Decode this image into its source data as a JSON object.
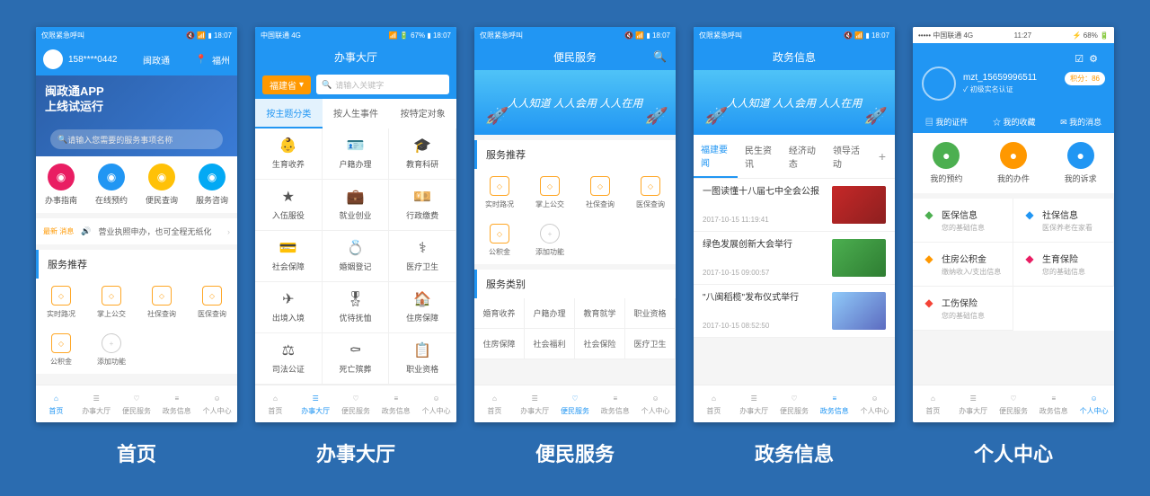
{
  "labels": [
    "首页",
    "办事大厅",
    "便民服务",
    "政务信息",
    "个人中心"
  ],
  "status": {
    "left": "仅限紧急呼叫",
    "right": "18:07",
    "carrier": "中国联通  4G",
    "batt": "67%",
    "time2": "11:27",
    "batt2": "68%"
  },
  "bottomTabs": [
    "首页",
    "办事大厅",
    "便民服务",
    "政务信息",
    "个人中心"
  ],
  "p1": {
    "phone": "158****0442",
    "app": "闽政通",
    "loc": "福州",
    "bannerL1": "闽政通APP",
    "bannerL2": "上线试运行",
    "searchPh": "请输入您需要的服务事项名称",
    "quick": [
      {
        "t": "办事指南",
        "c": "#e91e63"
      },
      {
        "t": "在线预约",
        "c": "#2196f3"
      },
      {
        "t": "便民查询",
        "c": "#ffc107"
      },
      {
        "t": "服务咨询",
        "c": "#03a9f4"
      }
    ],
    "noticeTag": "最新\n消息",
    "notice": "营业执照申办，也可全程无纸化",
    "sectTitle": "服务推荐",
    "svcs": [
      "实时路况",
      "掌上公交",
      "社保查询",
      "医保查询",
      "公积金",
      "添加功能"
    ]
  },
  "p2": {
    "title": "办事大厅",
    "prov": "福建省",
    "searchPh": "请输入关键字",
    "tabs": [
      "按主题分类",
      "按人生事件",
      "按特定对象"
    ],
    "items": [
      "生育收养",
      "户籍办理",
      "教育科研",
      "入伍服役",
      "就业创业",
      "行政缴费",
      "社会保障",
      "婚姻登记",
      "医疗卫生",
      "出境入境",
      "优待抚恤",
      "住房保障",
      "司法公证",
      "死亡殡葬",
      "职业资格"
    ]
  },
  "p3": {
    "title": "便民服务",
    "banner": "人人知道 人人会用 人人在用",
    "sect1": "服务推荐",
    "svcs": [
      "实时路况",
      "掌上公交",
      "社保查询",
      "医保查询",
      "公积金",
      "添加功能"
    ],
    "sect2": "服务类别",
    "cats": [
      "婚育收养",
      "户籍办理",
      "教育就学",
      "职业资格",
      "住房保障",
      "社会福利",
      "社会保险",
      "医疗卫生"
    ]
  },
  "p4": {
    "title": "政务信息",
    "banner": "人人知道 人人会用 人人在用",
    "tabs": [
      "福建要闻",
      "民生资讯",
      "经济动态",
      "领导活动"
    ],
    "news": [
      {
        "t": "一图读懂十八届七中全会公报",
        "d": "2017-10-15 11:19:41"
      },
      {
        "t": "绿色发展创新大会举行",
        "d": "2017-10-15 09:00:57"
      },
      {
        "t": "\"八闽稻榄\"发布仪式举行",
        "d": "2017-10-15 08:52:50"
      }
    ]
  },
  "p5": {
    "user": "mzt_15659996511",
    "verify": "初级实名认证",
    "score": "积分：86",
    "links": [
      "我的证件",
      "我的收藏",
      "我的消息"
    ],
    "acts": [
      {
        "t": "我的预约",
        "c": "#4caf50"
      },
      {
        "t": "我的办件",
        "c": "#ff9800"
      },
      {
        "t": "我的诉求",
        "c": "#2196f3"
      }
    ],
    "info": [
      {
        "t": "医保信息",
        "s": "您的基础信息",
        "c": "#4caf50"
      },
      {
        "t": "社保信息",
        "s": "医保养老在家看",
        "c": "#2196f3"
      },
      {
        "t": "住房公积金",
        "s": "缴纳收入/支出信息",
        "c": "#ff9800"
      },
      {
        "t": "生育保险",
        "s": "您的基础信息",
        "c": "#e91e63"
      },
      {
        "t": "工伤保险",
        "s": "您的基础信息",
        "c": "#f44336"
      }
    ]
  }
}
